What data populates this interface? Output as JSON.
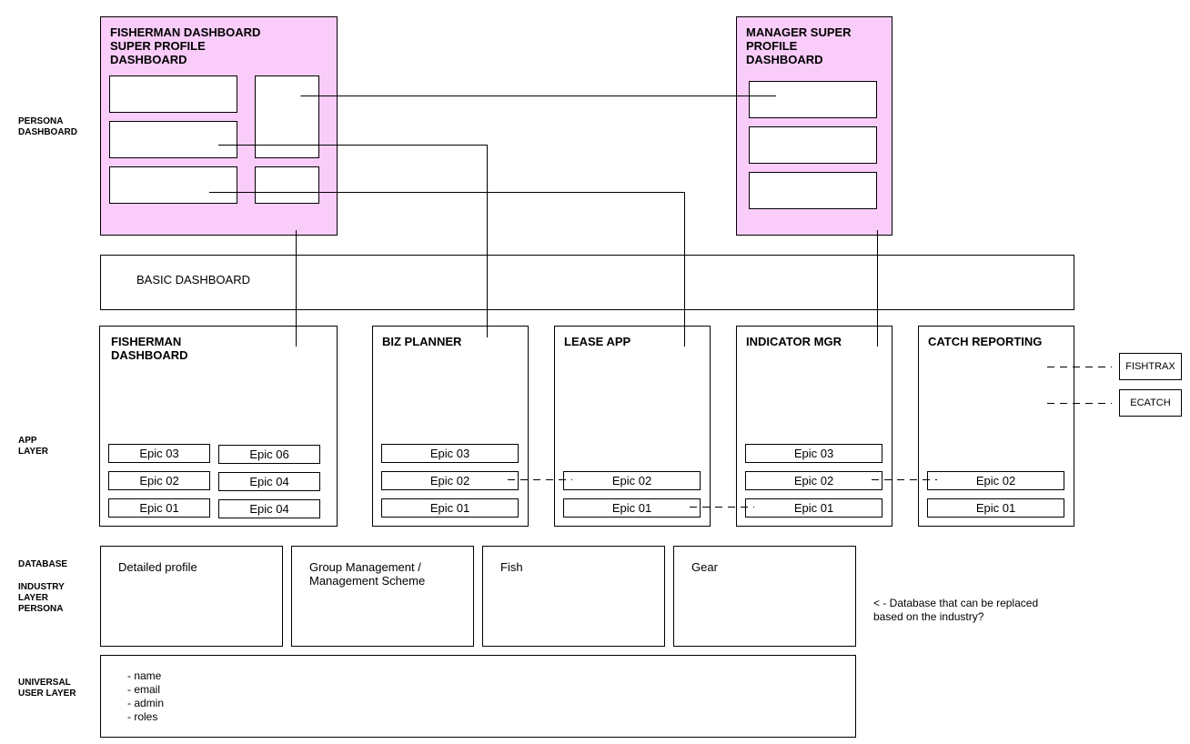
{
  "layers": {
    "persona": "PERSONA\nDASHBOARD",
    "app": "APP\nLAYER",
    "database": "DATABASE",
    "industry": "INDUSTRY\nLAYER\nPERSONA",
    "universal": "UNIVERSAL\nUSER LAYER"
  },
  "fisherman_super": {
    "title": "FISHERMAN DASHBOARD\nSUPER PROFILE\nDASHBOARD"
  },
  "manager_super": {
    "title": "MANAGER SUPER\nPROFILE\nDASHBOARD"
  },
  "basic_dashboard": {
    "label": "BASIC DASHBOARD"
  },
  "apps": {
    "fisherman": {
      "title": "FISHERMAN\nDASHBOARD",
      "epics_left": [
        "Epic 03",
        "Epic 02",
        "Epic 01"
      ],
      "epics_right": [
        "Epic 06",
        "Epic 04",
        "Epic 04"
      ]
    },
    "biz": {
      "title": "BIZ PLANNER",
      "epics": [
        "Epic 03",
        "Epic 02",
        "Epic 01"
      ]
    },
    "lease": {
      "title": "LEASE APP",
      "epics": [
        "Epic 02",
        "Epic 01"
      ]
    },
    "indicator": {
      "title": "INDICATOR MGR",
      "epics": [
        "Epic 03",
        "Epic 02",
        "Epic 01"
      ]
    },
    "catch": {
      "title": "CATCH REPORTING",
      "epics": [
        "Epic 02",
        "Epic 01"
      ]
    }
  },
  "external": {
    "fishtrax": "FISHTRAX",
    "ecatch": "ECATCH"
  },
  "databases": {
    "profile": "Detailed profile",
    "group": "Group Management /\nManagement Scheme",
    "fish": "Fish",
    "gear": "Gear"
  },
  "db_note": "< - Database that can be replaced\nbased on the industry?",
  "universal_items": [
    "- name",
    "- email",
    "- admin",
    "- roles"
  ],
  "colors": {
    "super_profile_fill": "#f9ccf9",
    "stroke": "#000000"
  }
}
